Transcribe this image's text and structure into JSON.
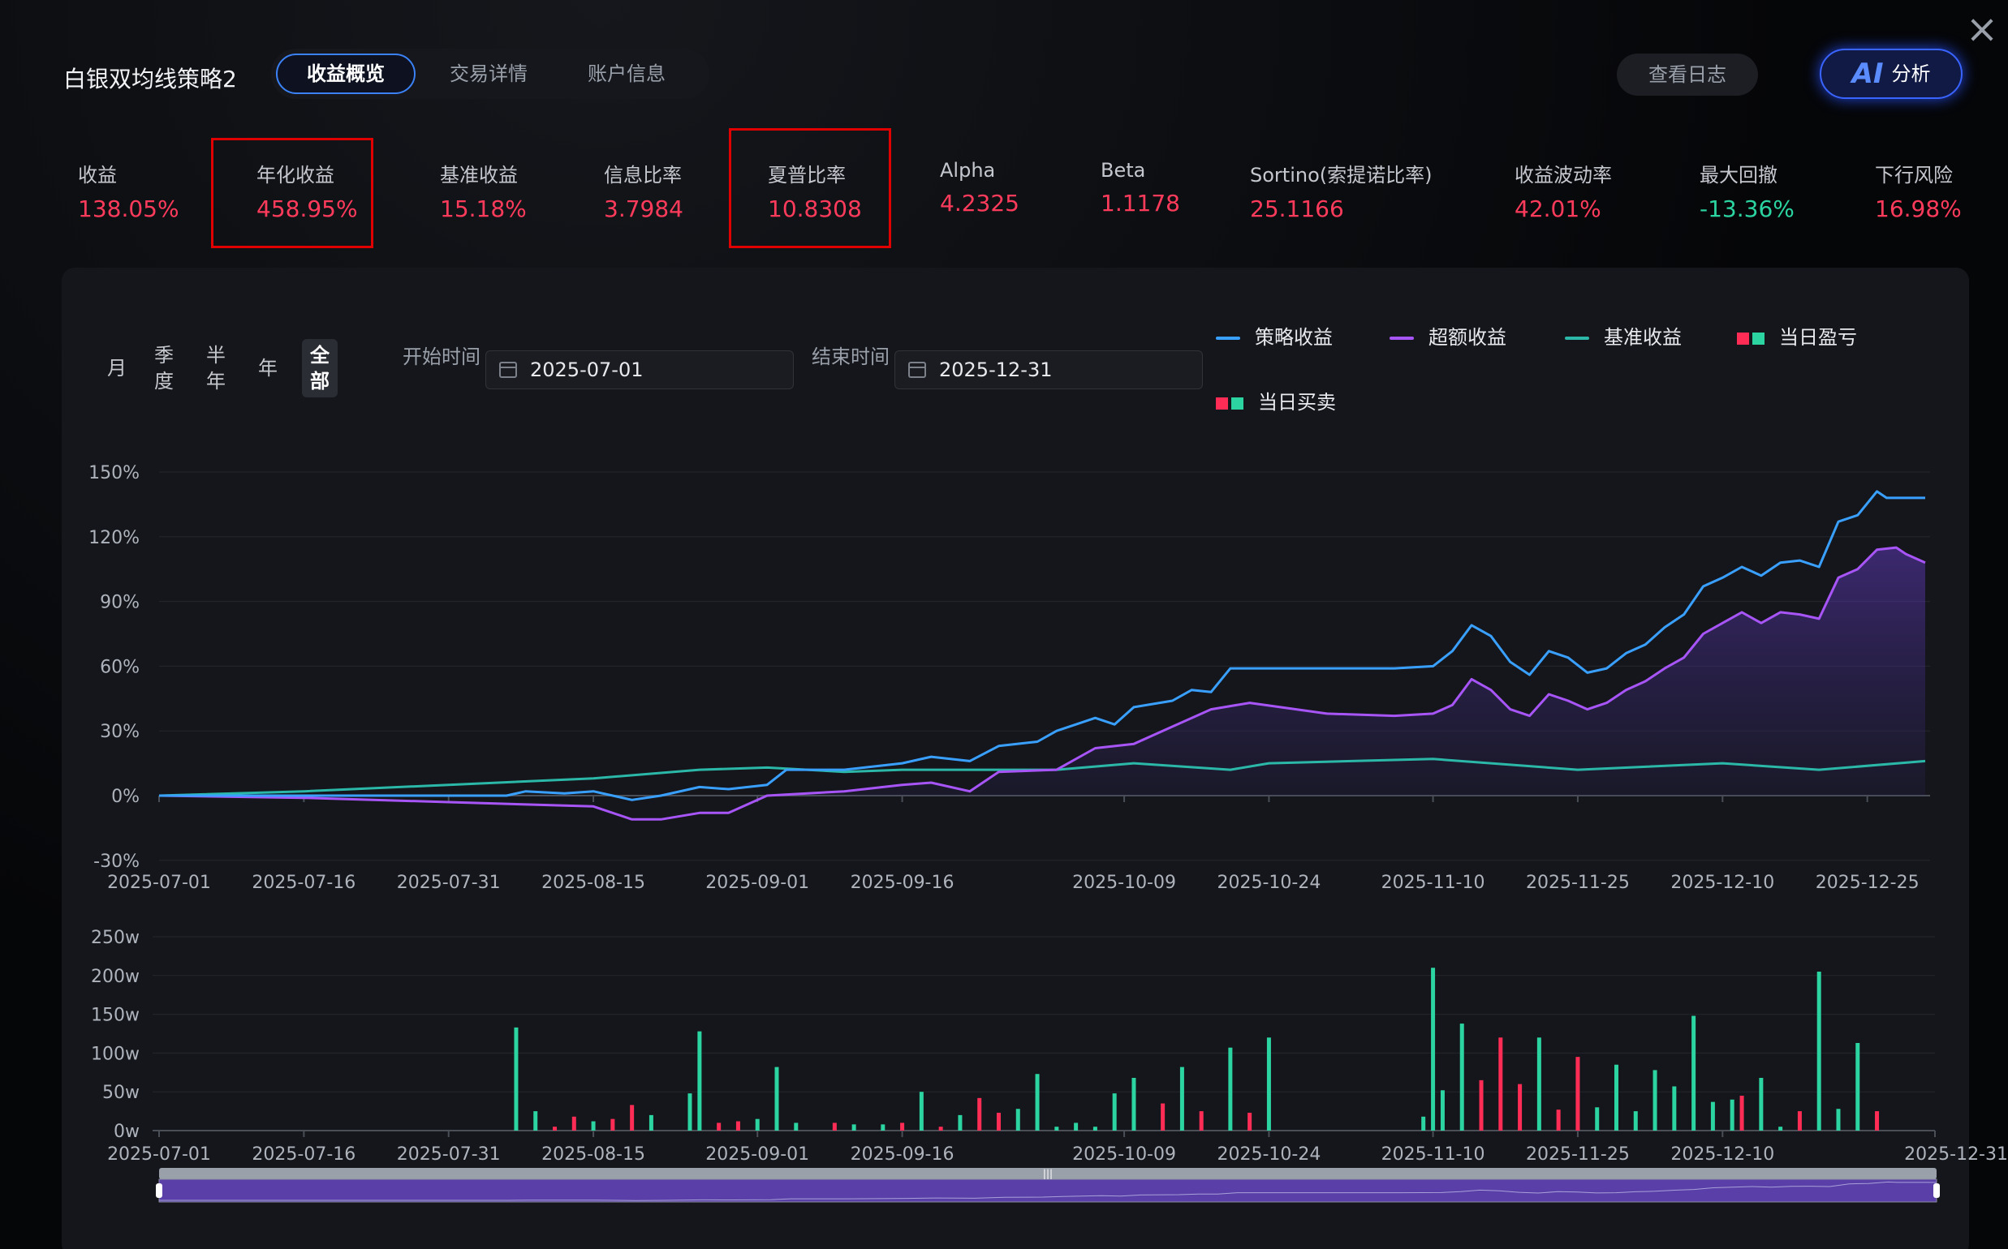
{
  "header": {
    "title": "白银双均线策略2",
    "tabs": [
      {
        "label": "收益概览",
        "active": true
      },
      {
        "label": "交易详情",
        "active": false
      },
      {
        "label": "账户信息",
        "active": false
      }
    ],
    "log_button": "查看日志",
    "ai_button": {
      "mark": "AI",
      "label": "分析"
    }
  },
  "metrics": [
    {
      "label": "收益",
      "value": "138.05%",
      "highlighted": false
    },
    {
      "label": "年化收益",
      "value": "458.95%",
      "highlighted": true
    },
    {
      "label": "基准收益",
      "value": "15.18%",
      "highlighted": false
    },
    {
      "label": "信息比率",
      "value": "3.7984",
      "highlighted": false
    },
    {
      "label": "夏普比率",
      "value": "10.8308",
      "highlighted": true
    },
    {
      "label": "Alpha",
      "value": "4.2325",
      "highlighted": false
    },
    {
      "label": "Beta",
      "value": "1.1178",
      "highlighted": false
    },
    {
      "label": "Sortino(索提诺比率)",
      "value": "25.1166",
      "highlighted": false
    },
    {
      "label": "收益波动率",
      "value": "42.01%",
      "highlighted": false
    },
    {
      "label": "最大回撤",
      "value": "-13.36%",
      "highlighted": false
    },
    {
      "label": "下行风险",
      "value": "16.98%",
      "highlighted": false
    }
  ],
  "controls": {
    "ranges": [
      {
        "label": "月",
        "active": false
      },
      {
        "label": "季度",
        "active": false
      },
      {
        "label": "半年",
        "active": false
      },
      {
        "label": "年",
        "active": false
      },
      {
        "label": "全部",
        "active": true
      }
    ],
    "start_label": "开始时间",
    "start_date": "2025-07-01",
    "end_label": "结束时间",
    "end_date": "2025-12-31"
  },
  "legend": {
    "strategy": "策略收益",
    "excess": "超额收益",
    "benchmark": "基准收益",
    "daily_pnl": "当日盈亏",
    "daily_trade": "当日买卖"
  },
  "colors": {
    "strategy": "#3aa0ff",
    "excess": "#a855f7",
    "benchmark": "#2bb8a8",
    "up": "#ff2d55",
    "down": "#2bd4a0",
    "accent": "#3b82f6"
  },
  "chart_data": [
    {
      "type": "line",
      "title": "",
      "x_tick_labels": [
        "2025-07-01",
        "2025-07-16",
        "2025-07-31",
        "2025-08-15",
        "2025-09-01",
        "2025-09-16",
        "2025-10-09",
        "2025-10-24",
        "2025-11-10",
        "2025-11-25",
        "2025-12-10",
        "2025-12-25"
      ],
      "y_tick_labels": [
        "150%",
        "120%",
        "90%",
        "60%",
        "30%",
        "0%",
        "-30%"
      ],
      "ylim": [
        -30,
        150
      ],
      "x_range": [
        "2025-07-01",
        "2025-12-31"
      ],
      "grid": true,
      "legend_position": "top-right",
      "series": [
        {
          "name": "策略收益",
          "points": [
            [
              "2025-07-01",
              0
            ],
            [
              "2025-08-06",
              0
            ],
            [
              "2025-08-08",
              2
            ],
            [
              "2025-08-12",
              1
            ],
            [
              "2025-08-15",
              2
            ],
            [
              "2025-08-19",
              -2
            ],
            [
              "2025-08-22",
              0
            ],
            [
              "2025-08-26",
              4
            ],
            [
              "2025-08-29",
              3
            ],
            [
              "2025-09-02",
              5
            ],
            [
              "2025-09-04",
              12
            ],
            [
              "2025-09-10",
              12
            ],
            [
              "2025-09-16",
              15
            ],
            [
              "2025-09-19",
              18
            ],
            [
              "2025-09-23",
              16
            ],
            [
              "2025-09-26",
              23
            ],
            [
              "2025-09-30",
              25
            ],
            [
              "2025-10-02",
              30
            ],
            [
              "2025-10-06",
              36
            ],
            [
              "2025-10-08",
              33
            ],
            [
              "2025-10-10",
              41
            ],
            [
              "2025-10-14",
              44
            ],
            [
              "2025-10-16",
              49
            ],
            [
              "2025-10-18",
              48
            ],
            [
              "2025-10-20",
              59
            ],
            [
              "2025-11-06",
              59
            ],
            [
              "2025-11-10",
              60
            ],
            [
              "2025-11-12",
              67
            ],
            [
              "2025-11-14",
              79
            ],
            [
              "2025-11-16",
              74
            ],
            [
              "2025-11-18",
              62
            ],
            [
              "2025-11-20",
              56
            ],
            [
              "2025-11-22",
              67
            ],
            [
              "2025-11-24",
              64
            ],
            [
              "2025-11-26",
              57
            ],
            [
              "2025-11-28",
              59
            ],
            [
              "2025-11-30",
              66
            ],
            [
              "2025-12-02",
              70
            ],
            [
              "2025-12-04",
              78
            ],
            [
              "2025-12-06",
              84
            ],
            [
              "2025-12-08",
              97
            ],
            [
              "2025-12-10",
              101
            ],
            [
              "2025-12-12",
              106
            ],
            [
              "2025-12-14",
              102
            ],
            [
              "2025-12-16",
              108
            ],
            [
              "2025-12-18",
              109
            ],
            [
              "2025-12-20",
              106
            ],
            [
              "2025-12-22",
              127
            ],
            [
              "2025-12-24",
              130
            ],
            [
              "2025-12-26",
              141
            ],
            [
              "2025-12-27",
              138
            ],
            [
              "2025-12-31",
              138
            ]
          ]
        },
        {
          "name": "超额收益",
          "points": [
            [
              "2025-07-01",
              0
            ],
            [
              "2025-07-16",
              -1
            ],
            [
              "2025-07-31",
              -3
            ],
            [
              "2025-08-15",
              -5
            ],
            [
              "2025-08-19",
              -11
            ],
            [
              "2025-08-22",
              -11
            ],
            [
              "2025-08-26",
              -8
            ],
            [
              "2025-08-29",
              -8
            ],
            [
              "2025-09-02",
              0
            ],
            [
              "2025-09-10",
              2
            ],
            [
              "2025-09-16",
              5
            ],
            [
              "2025-09-19",
              6
            ],
            [
              "2025-09-23",
              2
            ],
            [
              "2025-09-26",
              11
            ],
            [
              "2025-10-02",
              12
            ],
            [
              "2025-10-06",
              22
            ],
            [
              "2025-10-10",
              24
            ],
            [
              "2025-10-14",
              32
            ],
            [
              "2025-10-18",
              40
            ],
            [
              "2025-10-22",
              43
            ],
            [
              "2025-10-30",
              38
            ],
            [
              "2025-11-06",
              37
            ],
            [
              "2025-11-10",
              38
            ],
            [
              "2025-11-12",
              42
            ],
            [
              "2025-11-14",
              54
            ],
            [
              "2025-11-16",
              49
            ],
            [
              "2025-11-18",
              40
            ],
            [
              "2025-11-20",
              37
            ],
            [
              "2025-11-22",
              47
            ],
            [
              "2025-11-24",
              44
            ],
            [
              "2025-11-26",
              40
            ],
            [
              "2025-11-28",
              43
            ],
            [
              "2025-11-30",
              49
            ],
            [
              "2025-12-02",
              53
            ],
            [
              "2025-12-04",
              59
            ],
            [
              "2025-12-06",
              64
            ],
            [
              "2025-12-08",
              75
            ],
            [
              "2025-12-10",
              80
            ],
            [
              "2025-12-12",
              85
            ],
            [
              "2025-12-14",
              80
            ],
            [
              "2025-12-16",
              85
            ],
            [
              "2025-12-18",
              84
            ],
            [
              "2025-12-20",
              82
            ],
            [
              "2025-12-22",
              101
            ],
            [
              "2025-12-24",
              105
            ],
            [
              "2025-12-26",
              114
            ],
            [
              "2025-12-28",
              115
            ],
            [
              "2025-12-29",
              112
            ],
            [
              "2025-12-31",
              108
            ]
          ]
        },
        {
          "name": "基准收益",
          "points": [
            [
              "2025-07-01",
              0
            ],
            [
              "2025-07-16",
              2
            ],
            [
              "2025-07-31",
              5
            ],
            [
              "2025-08-15",
              8
            ],
            [
              "2025-08-26",
              12
            ],
            [
              "2025-09-02",
              13
            ],
            [
              "2025-09-10",
              11
            ],
            [
              "2025-09-16",
              12
            ],
            [
              "2025-10-02",
              12
            ],
            [
              "2025-10-10",
              15
            ],
            [
              "2025-10-20",
              12
            ],
            [
              "2025-10-24",
              15
            ],
            [
              "2025-11-10",
              17
            ],
            [
              "2025-11-25",
              12
            ],
            [
              "2025-12-10",
              15
            ],
            [
              "2025-12-20",
              12
            ],
            [
              "2025-12-31",
              16
            ]
          ]
        }
      ]
    },
    {
      "type": "bar",
      "title": "",
      "x_tick_labels": [
        "2025-07-01",
        "2025-07-16",
        "2025-07-31",
        "2025-08-15",
        "2025-09-01",
        "2025-09-16",
        "2025-10-09",
        "2025-10-24",
        "2025-11-10",
        "2025-11-25",
        "2025-12-10",
        "2025-12-31"
      ],
      "y_tick_labels": [
        "250w",
        "200w",
        "150w",
        "100w",
        "50w",
        "0w"
      ],
      "ylim": [
        0,
        250
      ],
      "unit": "w",
      "series": [
        {
          "name": "当日买卖",
          "bars": [
            [
              "2025-08-07",
              133,
              "down"
            ],
            [
              "2025-08-09",
              25,
              "down"
            ],
            [
              "2025-08-11",
              5,
              "up"
            ],
            [
              "2025-08-13",
              18,
              "up"
            ],
            [
              "2025-08-15",
              12,
              "down"
            ],
            [
              "2025-08-17",
              15,
              "up"
            ],
            [
              "2025-08-19",
              33,
              "up"
            ],
            [
              "2025-08-21",
              20,
              "down"
            ],
            [
              "2025-08-25",
              48,
              "down"
            ],
            [
              "2025-08-26",
              128,
              "down"
            ],
            [
              "2025-08-28",
              10,
              "up"
            ],
            [
              "2025-08-30",
              12,
              "up"
            ],
            [
              "2025-09-01",
              15,
              "down"
            ],
            [
              "2025-09-03",
              82,
              "down"
            ],
            [
              "2025-09-05",
              10,
              "down"
            ],
            [
              "2025-09-09",
              10,
              "up"
            ],
            [
              "2025-09-11",
              8,
              "down"
            ],
            [
              "2025-09-14",
              8,
              "down"
            ],
            [
              "2025-09-16",
              10,
              "up"
            ],
            [
              "2025-09-18",
              50,
              "down"
            ],
            [
              "2025-09-20",
              5,
              "up"
            ],
            [
              "2025-09-22",
              20,
              "down"
            ],
            [
              "2025-09-24",
              42,
              "up"
            ],
            [
              "2025-09-26",
              23,
              "up"
            ],
            [
              "2025-09-28",
              28,
              "down"
            ],
            [
              "2025-09-30",
              73,
              "down"
            ],
            [
              "2025-10-02",
              5,
              "down"
            ],
            [
              "2025-10-04",
              10,
              "down"
            ],
            [
              "2025-10-06",
              5,
              "down"
            ],
            [
              "2025-10-08",
              48,
              "down"
            ],
            [
              "2025-10-10",
              68,
              "down"
            ],
            [
              "2025-10-13",
              35,
              "up"
            ],
            [
              "2025-10-15",
              82,
              "down"
            ],
            [
              "2025-10-17",
              25,
              "up"
            ],
            [
              "2025-10-20",
              107,
              "down"
            ],
            [
              "2025-10-22",
              23,
              "up"
            ],
            [
              "2025-10-24",
              120,
              "down"
            ],
            [
              "2025-11-09",
              18,
              "down"
            ],
            [
              "2025-11-10",
              210,
              "down"
            ],
            [
              "2025-11-11",
              52,
              "down"
            ],
            [
              "2025-11-13",
              138,
              "down"
            ],
            [
              "2025-11-15",
              65,
              "up"
            ],
            [
              "2025-11-17",
              120,
              "up"
            ],
            [
              "2025-11-19",
              60,
              "up"
            ],
            [
              "2025-11-21",
              120,
              "down"
            ],
            [
              "2025-11-23",
              27,
              "up"
            ],
            [
              "2025-11-25",
              95,
              "up"
            ],
            [
              "2025-11-27",
              30,
              "down"
            ],
            [
              "2025-11-29",
              85,
              "down"
            ],
            [
              "2025-12-01",
              25,
              "down"
            ],
            [
              "2025-12-03",
              78,
              "down"
            ],
            [
              "2025-12-05",
              57,
              "down"
            ],
            [
              "2025-12-07",
              148,
              "down"
            ],
            [
              "2025-12-09",
              37,
              "down"
            ],
            [
              "2025-12-11",
              40,
              "down"
            ],
            [
              "2025-12-12",
              45,
              "up"
            ],
            [
              "2025-12-14",
              68,
              "down"
            ],
            [
              "2025-12-16",
              5,
              "down"
            ],
            [
              "2025-12-18",
              25,
              "up"
            ],
            [
              "2025-12-20",
              205,
              "down"
            ],
            [
              "2025-12-22",
              28,
              "down"
            ],
            [
              "2025-12-24",
              113,
              "down"
            ],
            [
              "2025-12-26",
              25,
              "up"
            ]
          ]
        }
      ]
    }
  ]
}
